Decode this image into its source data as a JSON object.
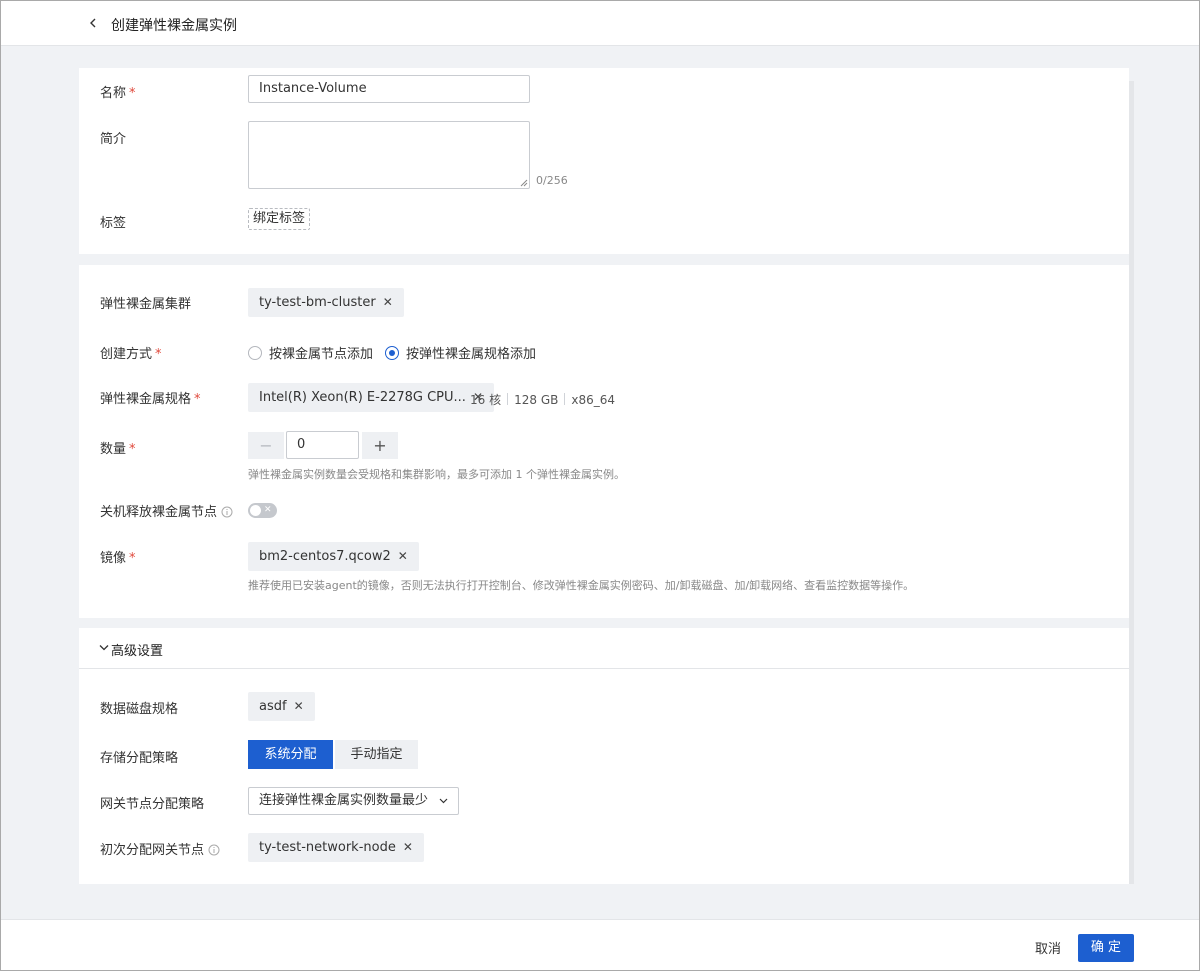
{
  "header": {
    "title": "创建弹性裸金属实例",
    "back_icon": "chevron-left-icon"
  },
  "basic": {
    "name_label": "名称",
    "name_value": "Instance-Volume",
    "desc_label": "简介",
    "desc_value": "",
    "desc_counter": "0/256",
    "tags_label": "标签",
    "bind_tags_button": "绑定标签"
  },
  "config": {
    "cluster_label": "弹性裸金属集群",
    "cluster_value": "ty-test-bm-cluster",
    "method_label": "创建方式",
    "method_options": [
      {
        "label": "按裸金属节点添加",
        "selected": false
      },
      {
        "label": "按弹性裸金属规格添加",
        "selected": true
      }
    ],
    "spec_label": "弹性裸金属规格",
    "spec_value": "Intel(R) Xeon(R) E-2278G CPU...",
    "spec_meta": [
      "16 核",
      "128 GB",
      "x86_64"
    ],
    "quantity_label": "数量",
    "quantity_value": "0",
    "quantity_minus": "−",
    "quantity_plus": "+",
    "quantity_hint": "弹性裸金属实例数量会受规格和集群影响，最多可添加 1 个弹性裸金属实例。",
    "release_label": "关机释放裸金属节点",
    "release_enabled": false,
    "image_label": "镜像",
    "image_value": "bm2-centos7.qcow2",
    "image_hint": "推荐使用已安装agent的镜像，否则无法执行打开控制台、修改弹性裸金属实例密码、加/卸载磁盘、加/卸载网络、查看监控数据等操作。"
  },
  "advanced": {
    "title": "高级设置",
    "expanded": true,
    "disk_spec_label": "数据磁盘规格",
    "disk_spec_value": "asdf",
    "storage_label": "存储分配策略",
    "storage_options": [
      {
        "label": "系统分配",
        "active": true
      },
      {
        "label": "手动指定",
        "active": false
      }
    ],
    "gateway_policy_label": "网关节点分配策略",
    "gateway_policy_value": "连接弹性裸金属实例数量最少",
    "initial_gateway_label": "初次分配网关节点",
    "initial_gateway_value": "ty-test-network-node"
  },
  "footer": {
    "cancel": "取消",
    "confirm": "确 定"
  },
  "colors": {
    "primary": "#1d5fd0",
    "required": "#e0483b",
    "page_bg": "#f0f2f5"
  }
}
